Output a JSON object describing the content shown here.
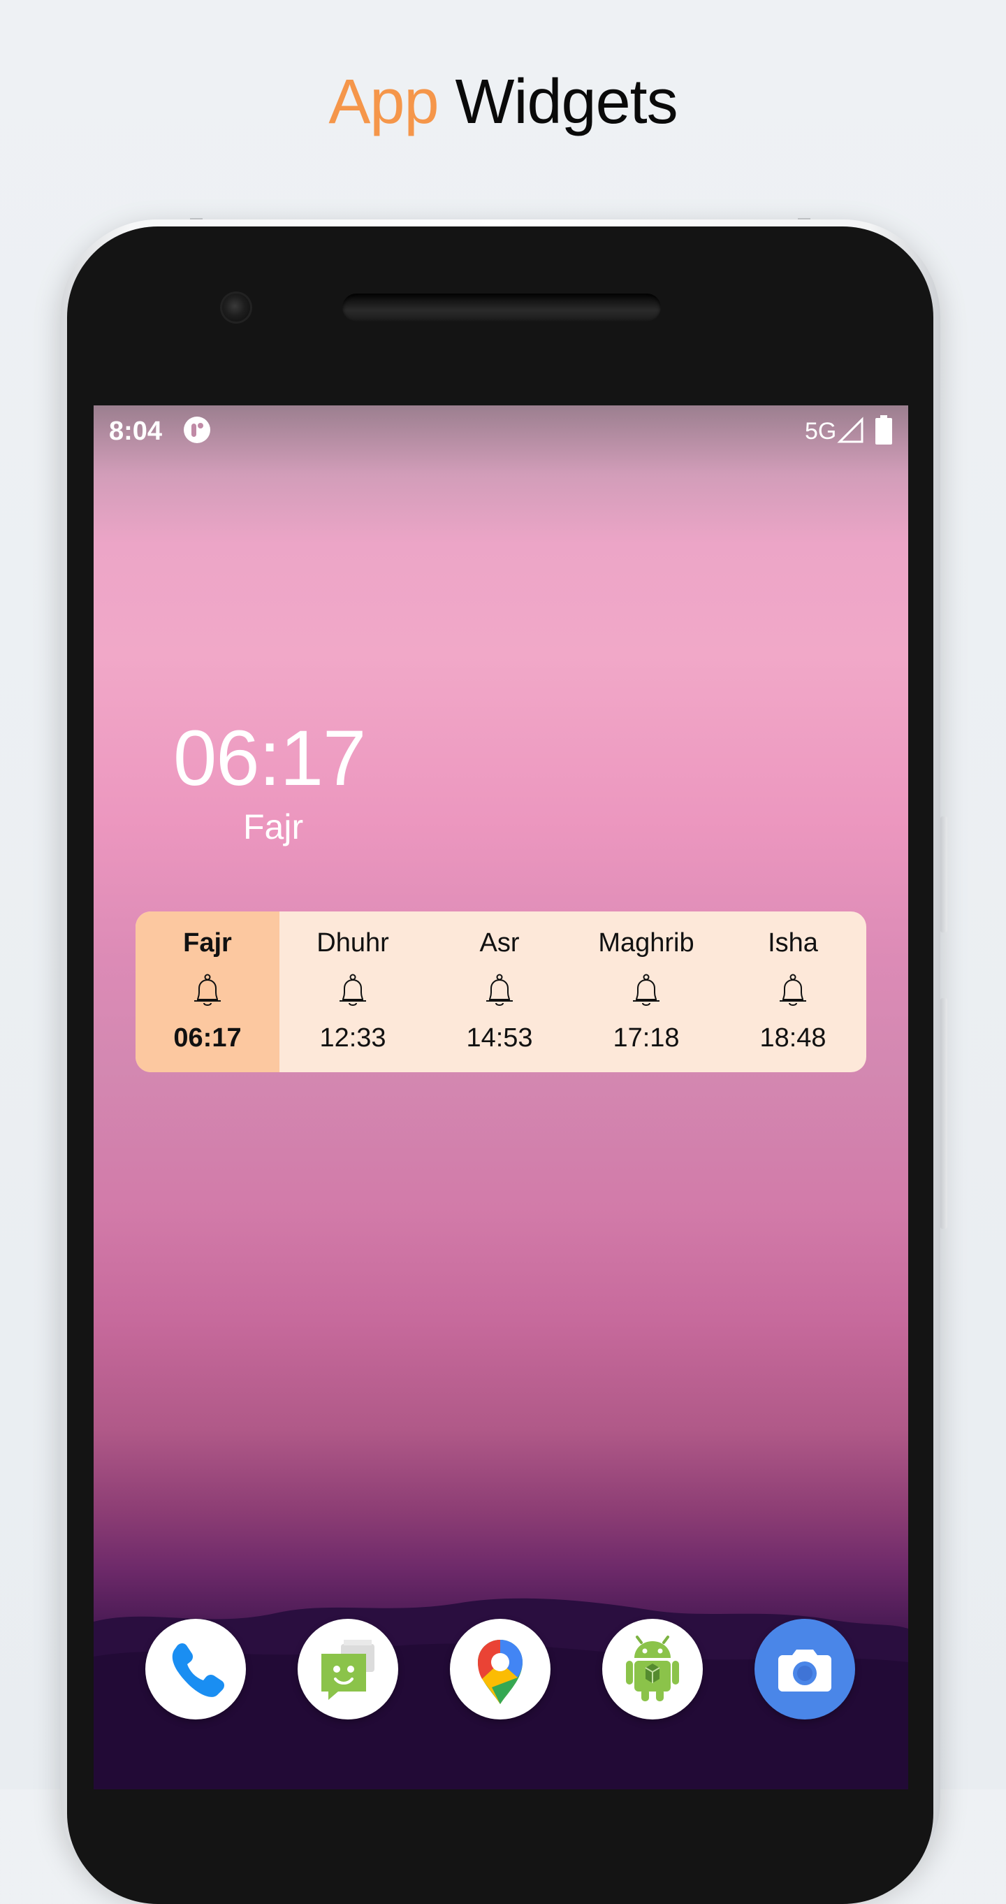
{
  "headline": {
    "accent": "App",
    "rest": "Widgets"
  },
  "status_bar": {
    "time": "8:04",
    "network": "5G",
    "icons": [
      "app-notification-icon",
      "signal-icon",
      "battery-icon"
    ]
  },
  "clock_widget": {
    "time": "06:17",
    "prayer": "Fajr"
  },
  "prayer_widget": {
    "prayers": [
      {
        "name": "Fajr",
        "time": "06:17",
        "active": true
      },
      {
        "name": "Dhuhr",
        "time": "12:33",
        "active": false
      },
      {
        "name": "Asr",
        "time": "14:53",
        "active": false
      },
      {
        "name": "Maghrib",
        "time": "17:18",
        "active": false
      },
      {
        "name": "Isha",
        "time": "18:48",
        "active": false
      }
    ],
    "colors": {
      "background": "#fde8d9",
      "active": "#fcc8a0"
    }
  },
  "dock": {
    "apps": [
      "phone-icon",
      "messages-icon",
      "maps-icon",
      "android-app-icon",
      "camera-icon"
    ]
  },
  "colors": {
    "accent": "#f5964a",
    "headline": "#0a0a0a"
  }
}
